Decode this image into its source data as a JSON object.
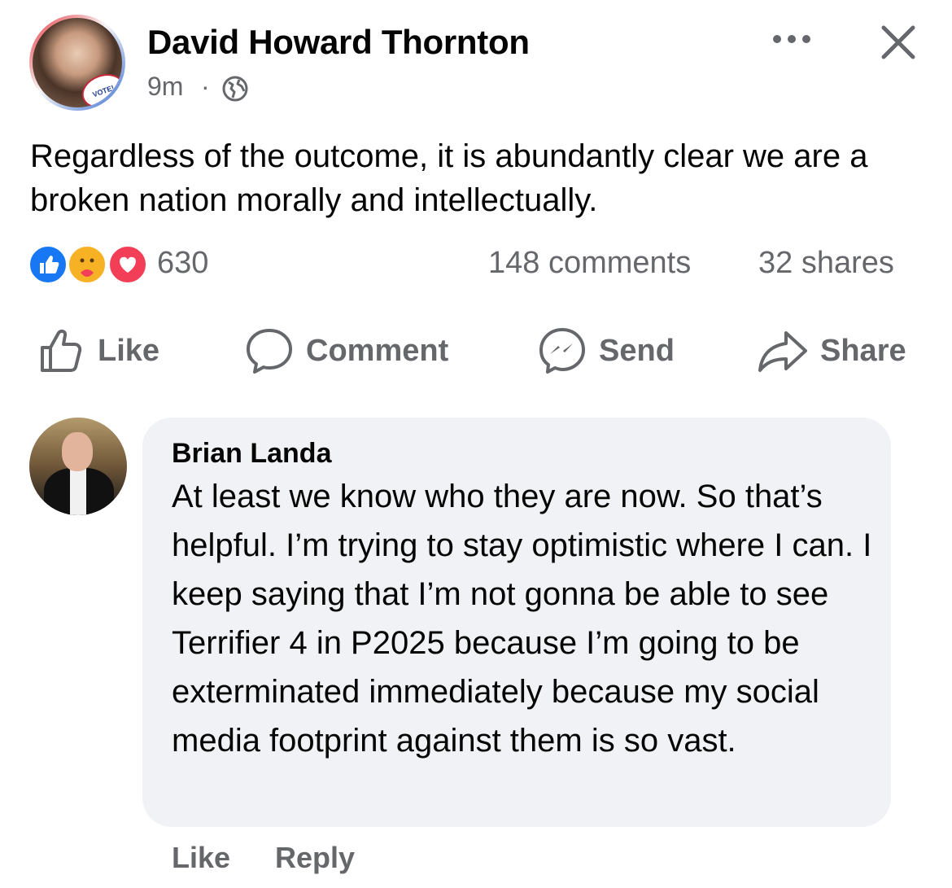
{
  "post": {
    "author": "David Howard Thornton",
    "time": "9m",
    "separator": "·",
    "audience_icon": "globe-icon",
    "avatar_badge": "VOTE!",
    "text": "Regardless of the outcome, it is abundantly clear we are a broken nation morally and intellectually.",
    "reactions": {
      "types": [
        "like",
        "care",
        "love"
      ],
      "count": "630",
      "comments": "148 comments",
      "shares": "32 shares"
    },
    "actions": {
      "like": "Like",
      "comment": "Comment",
      "send": "Send",
      "share": "Share"
    }
  },
  "comment": {
    "author": "Brian Landa",
    "text": "At least we know who they are now. So that’s helpful. I’m trying to stay optimistic where I can. I keep saying that I’m not gonna be able to see Terrifier 4 in P2025 because I’m going to be exterminated immediately because my social media footprint against them is so vast.",
    "like": "Like",
    "reply": "Reply"
  },
  "colors": {
    "primary_text": "#050505",
    "secondary_text": "#65676b",
    "bubble_bg": "#f0f2f5",
    "like_blue": "#1877f2",
    "love_red": "#f33e58",
    "care_yellow": "#f7b125"
  }
}
